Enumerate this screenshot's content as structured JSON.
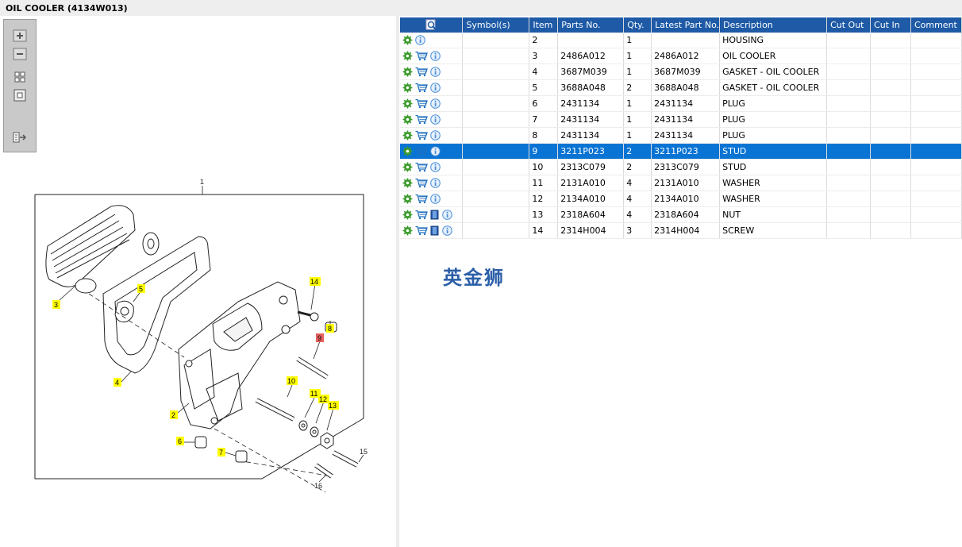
{
  "window": {
    "title": "OIL COOLER (4134W013)"
  },
  "zoom_toolbar": {
    "buttons": [
      {
        "name": "zoom-in-icon"
      },
      {
        "name": "zoom-out-icon"
      },
      {
        "name": "fit-all-icon"
      },
      {
        "name": "actual-size-icon"
      },
      {
        "name": "export-icon"
      }
    ]
  },
  "diagram": {
    "frame_label": "1",
    "callouts": [
      "2",
      "3",
      "4",
      "5",
      "6",
      "7",
      "8",
      "9",
      "10",
      "11",
      "12",
      "13",
      "14"
    ],
    "plain_labels": [
      "15",
      "16"
    ],
    "colors": {
      "highlight": "#ffff00",
      "selected_callout": "#e86060"
    }
  },
  "table": {
    "headers": [
      "",
      "Symbol(s)",
      "Item",
      "Parts No.",
      "Qty.",
      "Latest Part No.",
      "Description",
      "Cut Out",
      "Cut In",
      "Comment"
    ],
    "rows": [
      {
        "icons": [
          "gear",
          "info"
        ],
        "item": "2",
        "part": "",
        "qty": "1",
        "latest": "",
        "desc": "HOUSING"
      },
      {
        "icons": [
          "gear",
          "cart",
          "info"
        ],
        "item": "3",
        "part": "2486A012",
        "qty": "1",
        "latest": "2486A012",
        "desc": "OIL COOLER"
      },
      {
        "icons": [
          "gear",
          "cart",
          "info"
        ],
        "item": "4",
        "part": "3687M039",
        "qty": "1",
        "latest": "3687M039",
        "desc": "GASKET - OIL COOLER"
      },
      {
        "icons": [
          "gear",
          "cart",
          "info"
        ],
        "item": "5",
        "part": "3688A048",
        "qty": "2",
        "latest": "3688A048",
        "desc": "GASKET - OIL COOLER"
      },
      {
        "icons": [
          "gear",
          "cart",
          "info"
        ],
        "item": "6",
        "part": "2431134",
        "qty": "1",
        "latest": "2431134",
        "desc": "PLUG"
      },
      {
        "icons": [
          "gear",
          "cart",
          "info"
        ],
        "item": "7",
        "part": "2431134",
        "qty": "1",
        "latest": "2431134",
        "desc": "PLUG"
      },
      {
        "icons": [
          "gear",
          "cart",
          "info"
        ],
        "item": "8",
        "part": "2431134",
        "qty": "1",
        "latest": "2431134",
        "desc": "PLUG"
      },
      {
        "icons": [
          "gear",
          "cart",
          "info"
        ],
        "item": "9",
        "part": "3211P023",
        "qty": "2",
        "latest": "3211P023",
        "desc": "STUD",
        "selected": true
      },
      {
        "icons": [
          "gear",
          "cart",
          "info"
        ],
        "item": "10",
        "part": "2313C079",
        "qty": "2",
        "latest": "2313C079",
        "desc": "STUD"
      },
      {
        "icons": [
          "gear",
          "cart",
          "info"
        ],
        "item": "11",
        "part": "2131A010",
        "qty": "4",
        "latest": "2131A010",
        "desc": "WASHER"
      },
      {
        "icons": [
          "gear",
          "cart",
          "info"
        ],
        "item": "12",
        "part": "2134A010",
        "qty": "4",
        "latest": "2134A010",
        "desc": "WASHER"
      },
      {
        "icons": [
          "gear",
          "cart",
          "book",
          "info"
        ],
        "item": "13",
        "part": "2318A604",
        "qty": "4",
        "latest": "2318A604",
        "desc": "NUT"
      },
      {
        "icons": [
          "gear",
          "cart",
          "book",
          "info"
        ],
        "item": "14",
        "part": "2314H004",
        "qty": "3",
        "latest": "2314H004",
        "desc": "SCREW"
      }
    ]
  },
  "watermark": "英金狮",
  "colors": {
    "header_bg": "#1e5aa6",
    "selected_row": "#0a74d4",
    "gear": "#3a9a2a",
    "cart": "#1f6fc0",
    "info": "#4a8fd8"
  }
}
